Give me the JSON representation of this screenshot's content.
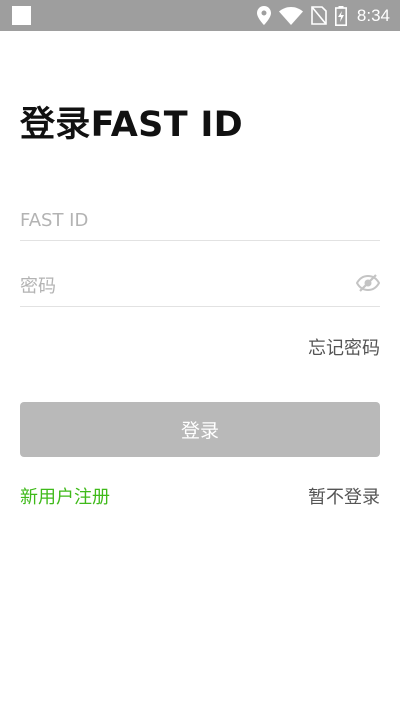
{
  "status_bar": {
    "time": "8:34",
    "icons": [
      "notification-square-icon",
      "location-pin-icon",
      "wifi-icon",
      "no-sim-icon",
      "battery-charging-icon"
    ]
  },
  "login": {
    "title": "登录FAST ID",
    "fastid_placeholder": "FAST ID",
    "fastid_value": "",
    "password_placeholder": "密码",
    "password_value": "",
    "password_visibility_icon": "eye-off-icon",
    "forgot_password": "忘记密码",
    "login_button": "登录",
    "register": "新用户注册",
    "skip": "暂不登录"
  },
  "colors": {
    "status_bar": "#9e9e9e",
    "accent_green": "#3fba1a",
    "button_disabled": "#b9b9b9",
    "placeholder": "#b3b3b3",
    "divider": "#e2e2e2"
  }
}
